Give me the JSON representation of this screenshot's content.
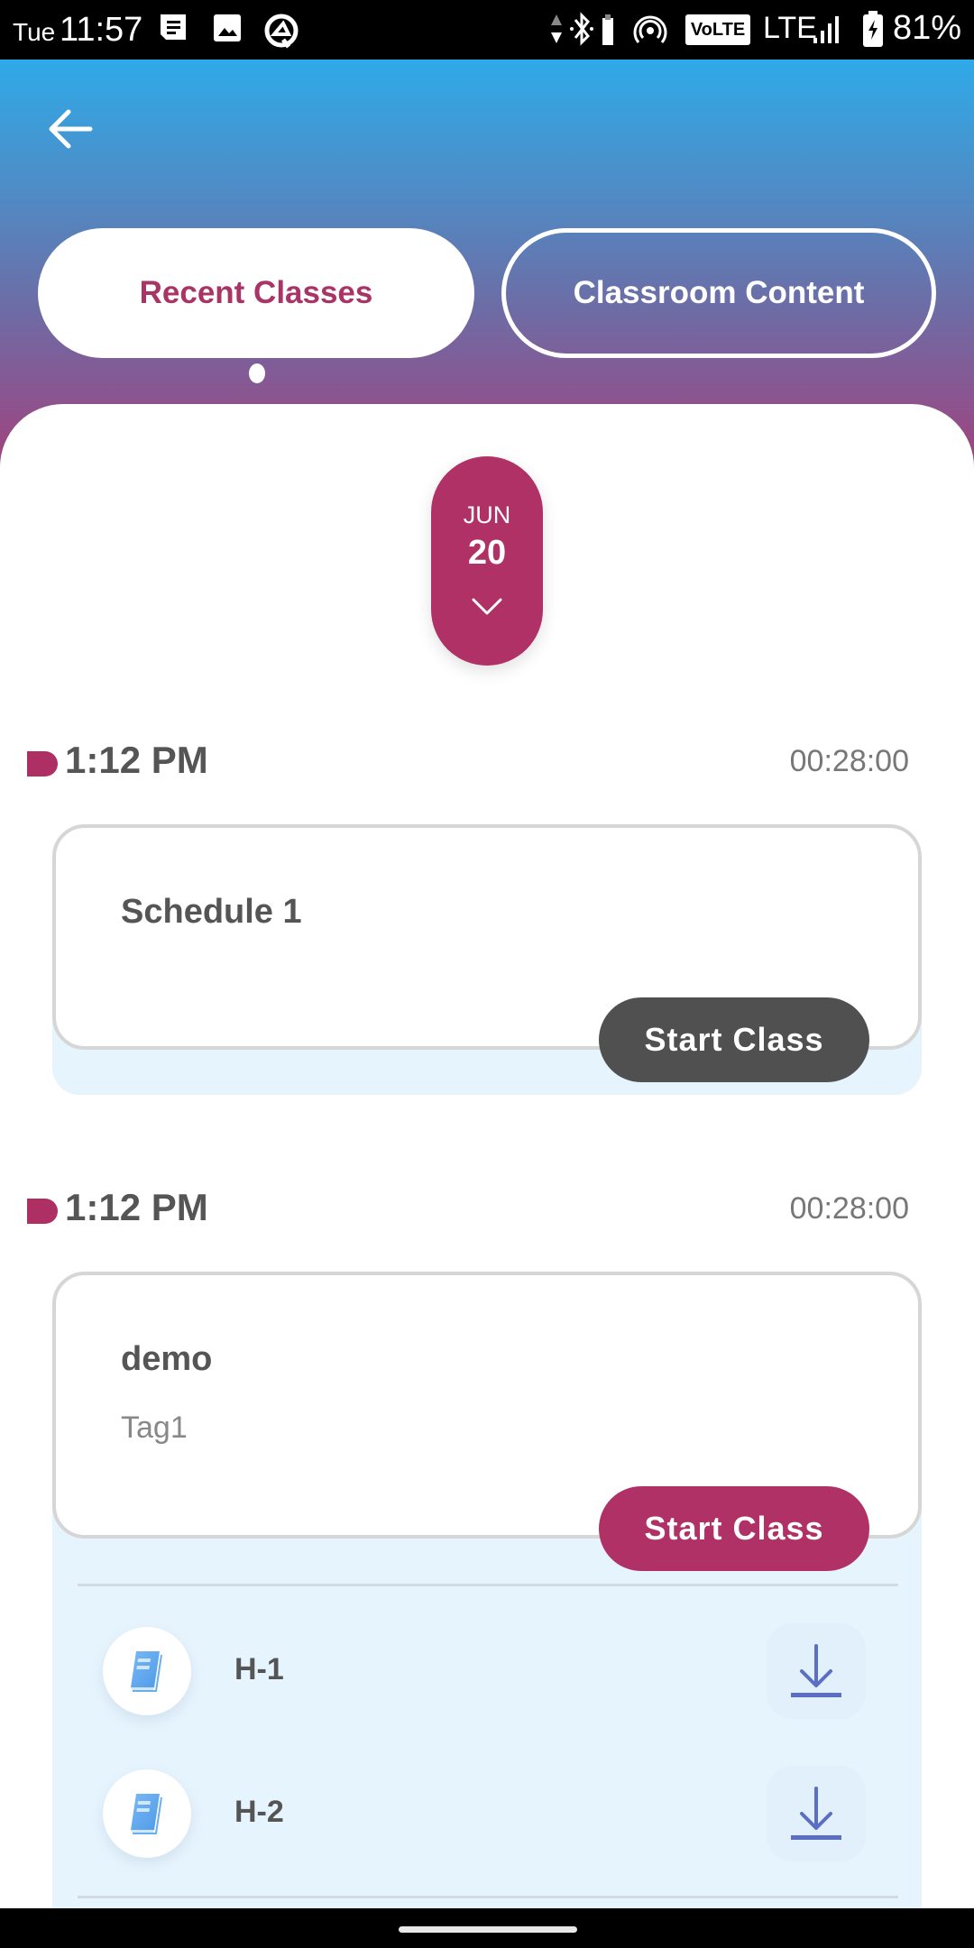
{
  "status_bar": {
    "day": "Tue",
    "time": "11:57",
    "left_icons": [
      "message-icon",
      "image-icon",
      "q-app-icon"
    ],
    "right_icons": [
      "data-arrows-icon",
      "bluetooth-icon",
      "battery-small-icon",
      "hotspot-icon",
      "volte-badge",
      "signal-icon",
      "battery-charging-icon"
    ],
    "volte": "VoLTE",
    "network": "LTE",
    "battery": "81%"
  },
  "header": {
    "back_icon": "arrow-left-icon",
    "tabs": [
      {
        "label": "Recent Classes",
        "active": true
      },
      {
        "label": "Classroom Content",
        "active": false
      }
    ]
  },
  "date_picker": {
    "month": "JUN",
    "day": "20",
    "icon": "chevron-down-icon"
  },
  "classes": [
    {
      "time": "1:12 PM",
      "duration": "00:28:00",
      "title": "Schedule 1",
      "tag": "",
      "button_label": "Start Class",
      "button_state": "disabled",
      "files": []
    },
    {
      "time": "1:12 PM",
      "duration": "00:28:00",
      "title": "demo",
      "tag": "Tag1",
      "button_label": "Start Class",
      "button_state": "enabled",
      "files": [
        {
          "name": "H-1",
          "icon": "book-icon",
          "action_icon": "download-icon"
        },
        {
          "name": "H-2",
          "icon": "book-icon",
          "action_icon": "download-icon"
        }
      ]
    }
  ],
  "colors": {
    "accent": "#b03166",
    "gradient_top": "#2eaae8",
    "gradient_bottom": "#a83a74",
    "disabled_button": "#505050",
    "files_panel_bg": "#e6f4fd",
    "download_icon": "#5a6fc4"
  }
}
